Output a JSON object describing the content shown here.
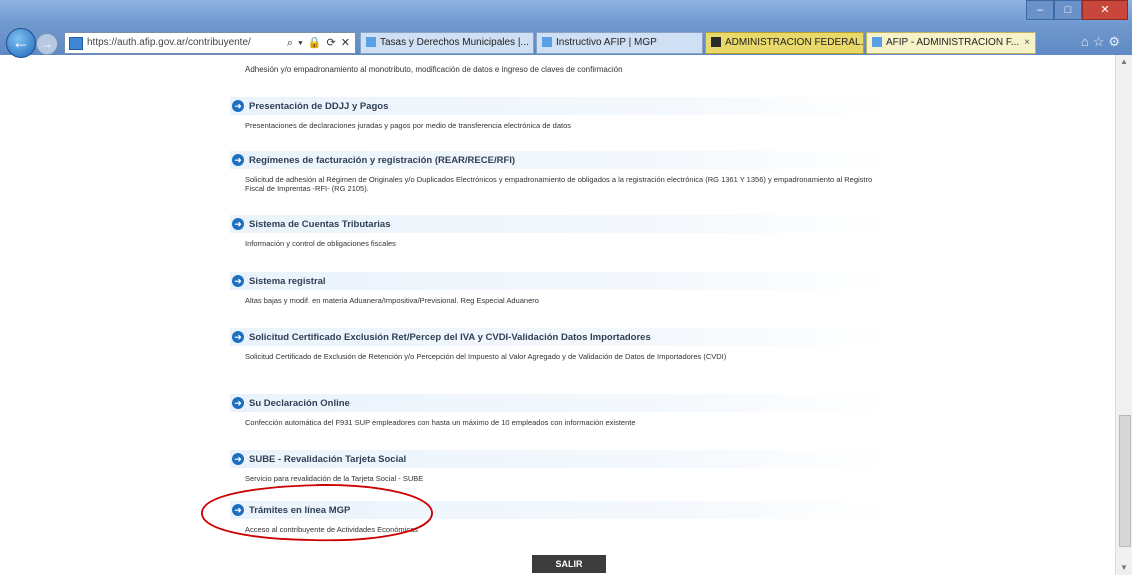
{
  "browser": {
    "url": "https://auth.afip.gov.ar/contribuyente/",
    "address_controls": "⌕ ▾ 🔒 ⟳ ✕",
    "tabs": [
      {
        "label": "Tasas y Derechos Municipales |..."
      },
      {
        "label": "Instructivo AFIP | MGP"
      },
      {
        "label": "ADMINISTRACION FEDERAL..."
      },
      {
        "label": "AFIP - ADMINISTRACION F..."
      }
    ],
    "active_tab_close": "×"
  },
  "page": {
    "top_description": "Adhesión y/o empadronamiento al monotributo, modificación de datos e ingreso de claves de confirmación",
    "items": [
      {
        "title": "Presentación de DDJJ y Pagos",
        "description": "Presentaciones de declaraciones juradas y pagos por medio de transferencia electrónica de datos"
      },
      {
        "title": "Regímenes de facturación y registración (REAR/RECE/RFI)",
        "description": "Solicitud de adhesión al Régimen de Originales y/o Duplicados Electrónicos y empadronamiento de obligados a la registración electrónica (RG 1361 Y 1356) y empadronamiento al Registro Fiscal de Imprentas -RFI- (RG 2105)."
      },
      {
        "title": "Sistema de Cuentas Tributarias",
        "description": "Información y control de obligaciones fiscales"
      },
      {
        "title": "Sistema registral",
        "description": "Altas bajas y modif. en materia Aduanera/Impositiva/Previsional. Reg Especial Aduanero"
      },
      {
        "title": "Solicitud Certificado Exclusión Ret/Percep del IVA y CVDI-Validación Datos Importadores",
        "description": "Solicitud Certificado de Exclusión de Retención y/o Percepción del Impuesto al Valor Agregado y de Validación de Datos de Importadores (CVDI)"
      },
      {
        "title": "Su Declaración Online",
        "description": "Confección automática del F931 SUP empleadores con hasta un máximo de 10 empleados con información existente"
      },
      {
        "title": "SUBE - Revalidación Tarjeta Social",
        "description": "Servicio para revalidación de la Tarjeta Social - SUBE"
      },
      {
        "title": "Trámites en línea MGP",
        "description": "Acceso al contribuyente de Actividades Económicas"
      }
    ],
    "exit_label": "SALIR"
  },
  "colors": {
    "accent": "#1d6fc0",
    "annotation": "#cc0000"
  }
}
